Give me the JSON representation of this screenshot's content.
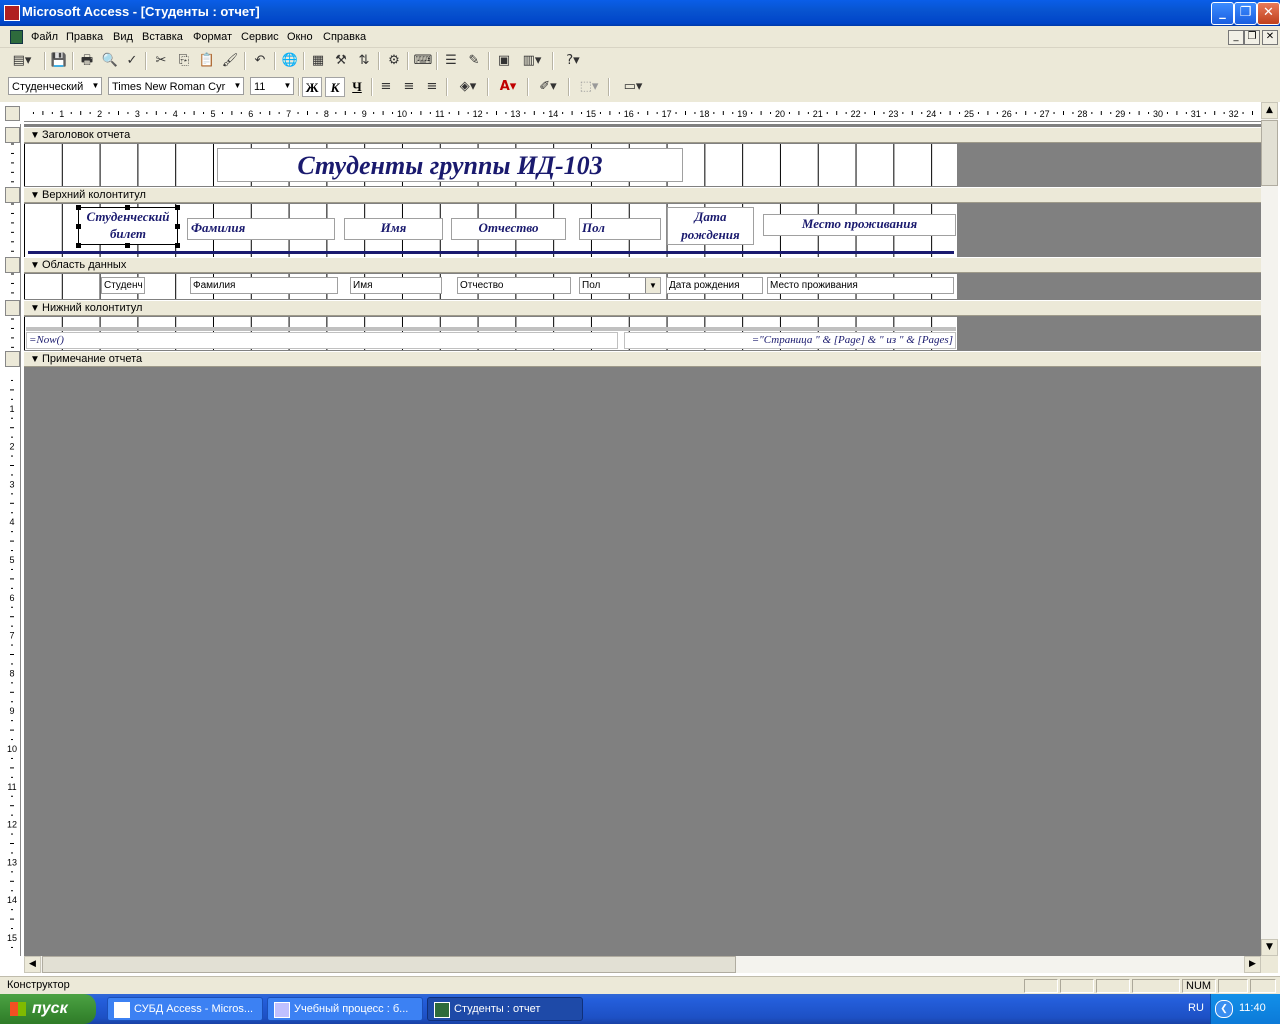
{
  "window": {
    "title": "Microsoft Access - [Студенты : отчет]"
  },
  "menu": [
    "Файл",
    "Правка",
    "Вид",
    "Вставка",
    "Формат",
    "Сервис",
    "Окно",
    "Справка"
  ],
  "formatting": {
    "object": "Студенческий",
    "font": "Times New Roman Cyr",
    "size": "11",
    "bold": "Ж",
    "italic": "К",
    "underline": "Ч"
  },
  "ruler": {
    "h_marks": [
      "1",
      "2",
      "3",
      "4",
      "5",
      "6",
      "7",
      "8",
      "9",
      "10",
      "11",
      "12",
      "13",
      "14",
      "15",
      "16",
      "17",
      "18",
      "19",
      "20",
      "21",
      "22",
      "23",
      "24",
      "25",
      "26",
      "27",
      "28",
      "29",
      "30",
      "31",
      "32"
    ],
    "v_marks": [
      "1",
      "2",
      "3",
      "4",
      "5",
      "6",
      "7",
      "8",
      "9",
      "10",
      "11",
      "12",
      "13",
      "14",
      "15"
    ]
  },
  "sections": {
    "report_header": "Заголовок отчета",
    "page_header": "Верхний колонтитул",
    "detail": "Область данных",
    "page_footer": "Нижний колонтитул",
    "report_footer": "Примечание отчета"
  },
  "report_title": "Студенты группы ИД-103",
  "header_labels": {
    "student_id_line1": "Студенческий",
    "student_id_line2": "билет",
    "surname": "Фамилия",
    "name": "Имя",
    "patronymic": "Отчество",
    "gender": "Пол",
    "birth_line1": "Дата",
    "birth_line2": "рождения",
    "residence": "Место проживания"
  },
  "fields": {
    "student_id": "Студенч",
    "surname": "Фамилия",
    "name": "Имя",
    "patronymic": "Отчество",
    "gender": "Пол",
    "birth": "Дата рождения",
    "residence": "Место проживания"
  },
  "footer": {
    "now_expr": "=Now()",
    "page_expr": "=\"Страница \" & [Page] & \" из \" & [Pages]"
  },
  "status": {
    "mode": "Конструктор",
    "num": "NUM"
  },
  "taskbar": {
    "start": "пуск",
    "tasks": [
      "СУБД Access - Micros...",
      "Учебный процесс : б...",
      "Студенты : отчет"
    ],
    "lang": "RU",
    "clock": "11:40"
  },
  "colors": {
    "title_blue": "#1a1a6e",
    "design_gray": "#808080"
  }
}
